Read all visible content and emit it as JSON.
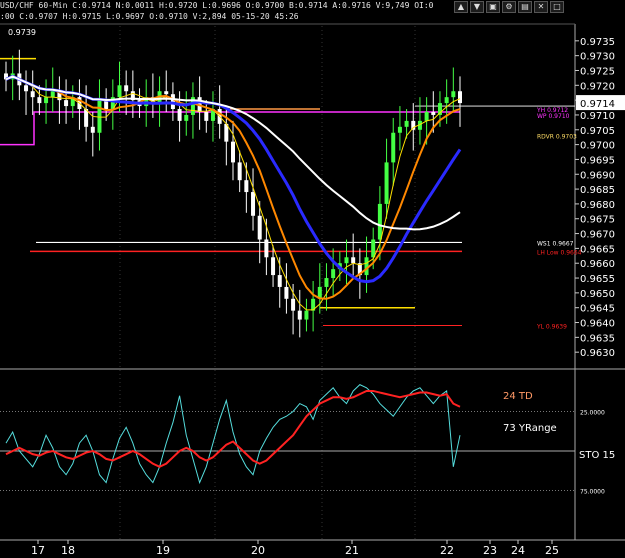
{
  "window": {
    "title_line": "USD/CHF 60-Min  C:0.9714  N:0.0011  H:0.9720  L:0.9696  O:0.9700  B:0.9714  A:0.9716  V:9,749  OI:0",
    "sub_line": ":00  C:0.9707  H:0.9715  L:0.9697  O:0.9710  V:2,894  05-15-20  45:26",
    "buttons": [
      "▲",
      "▼",
      "▣",
      "⚙",
      "▤",
      "✕",
      "□"
    ]
  },
  "colors": {
    "background": "#000000",
    "candle_up": "#44ff44",
    "candle_down": "#ffffff",
    "ma_blue": "#2a2aff",
    "ma_white": "#ffffff",
    "ma_orange": "#ff8800",
    "ma_yellow": "#ffe000",
    "magenta": "#ff33ff",
    "red": "#ff2222",
    "stoch_cyan": "#55dddd",
    "stoch_red": "#ff2222"
  },
  "chart_data": [
    {
      "type": "line",
      "symbol": "USD/CHF",
      "interval": "60-Min",
      "ylim": [
        0.9625,
        0.974
      ],
      "y_ticks": [
        "0.9735",
        "0.9730",
        "0.9725",
        "0.9720",
        "0.9715",
        "0.9710",
        "0.9705",
        "0.9700",
        "0.9695",
        "0.9690",
        "0.9685",
        "0.9680",
        "0.9675",
        "0.9670",
        "0.9665",
        "0.9660",
        "0.9655",
        "0.9650",
        "0.9645",
        "0.9640",
        "0.9635",
        "0.9630"
      ],
      "top_left_value": "0.9739",
      "last_price": "0.9714",
      "x_ticks": [
        "17",
        "18",
        "19",
        "20",
        "21",
        "22",
        "23",
        "24",
        "25"
      ],
      "series": [
        {
          "values": [
            0.9722,
            0.9724,
            0.972,
            0.9718,
            0.9716,
            0.9714,
            0.9716,
            0.9718,
            0.9715,
            0.9713,
            0.9716,
            0.9712,
            0.9706,
            0.9704,
            0.9715,
            0.9712,
            0.9716,
            0.972,
            0.9718,
            0.9715,
            0.9713,
            0.9716,
            0.9714,
            0.9718,
            0.9717,
            0.9712,
            0.9708,
            0.971,
            0.9716,
            0.9711,
            0.9708,
            0.9712,
            0.9707,
            0.9701,
            0.9694,
            0.9688,
            0.9684,
            0.9676,
            0.9668,
            0.9662,
            0.9656,
            0.9652,
            0.9648,
            0.9644,
            0.9641,
            0.9644,
            0.9648,
            0.9652,
            0.9655,
            0.9658,
            0.966,
            0.9662,
            0.966,
            0.9656,
            0.9662,
            0.9668,
            0.968,
            0.9694,
            0.9704,
            0.9706,
            0.9708,
            0.9705,
            0.9708,
            0.9711,
            0.971,
            0.9714,
            0.9716,
            0.9718,
            0.9714
          ]
        }
      ],
      "annotations": [
        {
          "text": "YH 0.9712",
          "value": 0.9712
        },
        {
          "text": "WP 0.9710",
          "value": 0.971
        },
        {
          "text": "RDVR 0.9703",
          "value": 0.9703
        },
        {
          "text": "WS1 0.9667",
          "value": 0.9667
        },
        {
          "text": "LH Low 0.9664",
          "value": 0.9664
        },
        {
          "text": "YL 0.9639",
          "value": 0.9639
        }
      ]
    },
    {
      "type": "line",
      "y_ticks": [
        "25.0000",
        "75.0000"
      ],
      "labels": [
        "24 TD",
        "73 YRange",
        "STO 15"
      ],
      "series": [
        {
          "values": [
            55,
            62,
            50,
            45,
            40,
            48,
            60,
            52,
            40,
            35,
            42,
            55,
            60,
            50,
            35,
            30,
            45,
            58,
            65,
            55,
            42,
            35,
            30,
            40,
            55,
            68,
            85,
            60,
            45,
            30,
            40,
            55,
            70,
            82,
            62,
            48,
            40,
            35,
            50,
            58,
            65,
            70,
            72,
            75,
            80,
            78,
            70,
            82,
            86,
            90,
            84,
            80,
            88,
            92,
            90,
            86,
            80,
            76,
            72,
            78,
            84,
            88,
            90,
            85,
            80,
            85,
            88,
            40,
            60
          ]
        },
        {
          "values": [
            48,
            50,
            52,
            50,
            48,
            47,
            49,
            50,
            48,
            46,
            45,
            47,
            49,
            50,
            48,
            45,
            44,
            46,
            48,
            50,
            48,
            45,
            42,
            40,
            42,
            46,
            50,
            52,
            50,
            46,
            44,
            46,
            50,
            54,
            56,
            52,
            48,
            44,
            42,
            44,
            48,
            52,
            56,
            60,
            66,
            72,
            76,
            80,
            82,
            84,
            84,
            83,
            84,
            86,
            88,
            88,
            87,
            86,
            85,
            84,
            85,
            86,
            87,
            87,
            86,
            85,
            86,
            80,
            78
          ]
        }
      ]
    }
  ]
}
